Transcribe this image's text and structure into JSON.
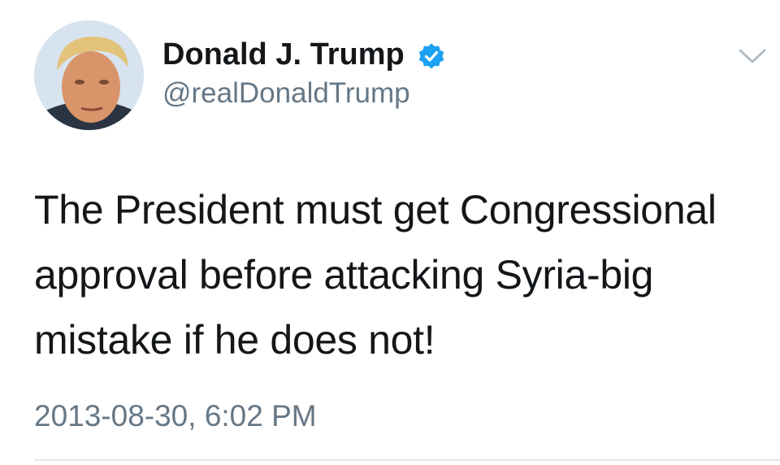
{
  "tweet": {
    "author": {
      "display_name": "Donald J. Trump",
      "handle": "@realDonaldTrump",
      "verified": true
    },
    "text": "The President must get Congressional approval before attacking Syria-big mistake if he does not!",
    "timestamp": "2013-08-30, 6:02 PM"
  },
  "icons": {
    "verified": "verified-badge-icon",
    "menu": "chevron-down-icon"
  },
  "colors": {
    "verified_blue": "#1da1f2",
    "primary_text": "#14171a",
    "secondary_text": "#657786",
    "divider": "#e1e8ed"
  }
}
